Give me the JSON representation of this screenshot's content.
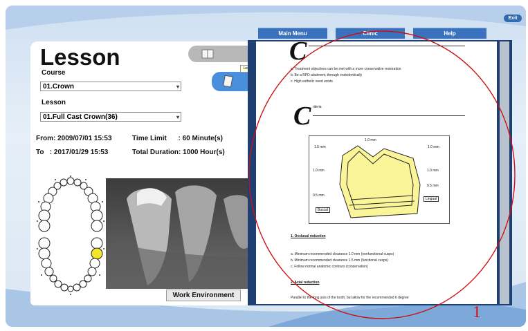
{
  "app": {
    "exit_label": "Exit"
  },
  "menu": {
    "items": [
      "Main Menu",
      "Clinic",
      "Help"
    ]
  },
  "lesson_panel": {
    "title": "Lesson",
    "course_label": "Course",
    "course_value": "01.Crown",
    "lesson_label": "Lesson",
    "lesson_value": "01.Full Cast Crown(36)",
    "tooltip": "Lecture",
    "from_line": "From: 2009/07/01 15:53",
    "to_line": "To   : 2017/01/29 15:53",
    "time_limit_line": "Time Limit      : 60 Minute(s)",
    "duration_line": "Total Duration: 1000 Hour(s)",
    "work_env_label": "Work Environment"
  },
  "document": {
    "heading1_letter": "C",
    "intro_lines": [
      "a.  Treatment objectives can be met with a more conservative restoration",
      "b.  Be a RPD abutment, through endodontically",
      "c.  High esthetic need exists"
    ],
    "heading2_letter": "C",
    "heading2_suffix": "riteria",
    "figure_labels": {
      "top": "1.0 mm",
      "top_right": "1.0 mm",
      "left_upper": "1.5 mm",
      "left_mid": "1.0 mm",
      "right_mid": "1.0 mm",
      "left_low": "0.5 mm",
      "right_low": "0.5 mm",
      "buccal": "Buccal",
      "lingual": "Lingual"
    },
    "section1_title": "1.  Occlusal reduction",
    "section1_lines": [
      "a.  Minimum recommended clearance 1.0 mm (nonfunctional cusps)",
      "b.  Minimum recommended clearance 1.5 mm (functional cusps)",
      "c.  Follow normal anatomic contours (conservation)"
    ],
    "section2_title": "2.  Axial reduction",
    "section2_line": "Parallel to the long axis of the tooth, but allow for the recommended 6 degree"
  },
  "annotation": {
    "number": "1",
    "color": "#cc1111"
  },
  "colors": {
    "menu_blue": "#3b72bd",
    "viewer_navy": "#1f3f72",
    "highlight_tooth": "#f2e62a",
    "figure_fill": "#fbf59a"
  }
}
